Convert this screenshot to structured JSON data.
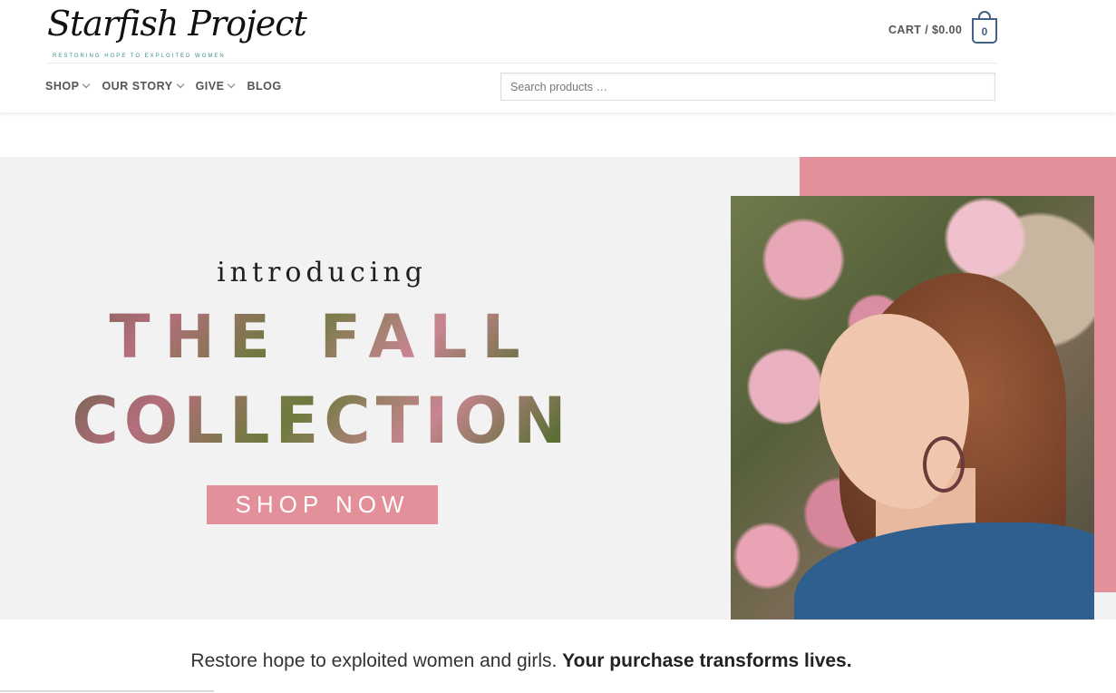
{
  "header": {
    "logo_text": "Starfish Project",
    "logo_tagline": "RESTORING HOPE TO EXPLOITED WOMEN",
    "cart_label": "CART /",
    "cart_total": "$0.00",
    "cart_count": "0",
    "search_placeholder": "Search products …"
  },
  "nav": {
    "items": [
      {
        "label": "SHOP",
        "has_dropdown": true
      },
      {
        "label": "OUR STORY",
        "has_dropdown": true
      },
      {
        "label": "GIVE",
        "has_dropdown": true
      },
      {
        "label": "BLOG",
        "has_dropdown": false
      }
    ]
  },
  "hero": {
    "intro": "introducing",
    "title_line1": "THE FALL",
    "title_line2": "COLLECTION",
    "cta": "SHOP NOW"
  },
  "tagline": {
    "regular": "Restore hope to exploited women and girls.",
    "bold": "Your purchase transforms lives."
  },
  "colors": {
    "accent_pink": "#e3909b",
    "cart_blue": "#446084",
    "hero_bg": "#f2f2f2"
  },
  "icons": [
    "cart-bag-icon",
    "chevron-down-icon"
  ]
}
